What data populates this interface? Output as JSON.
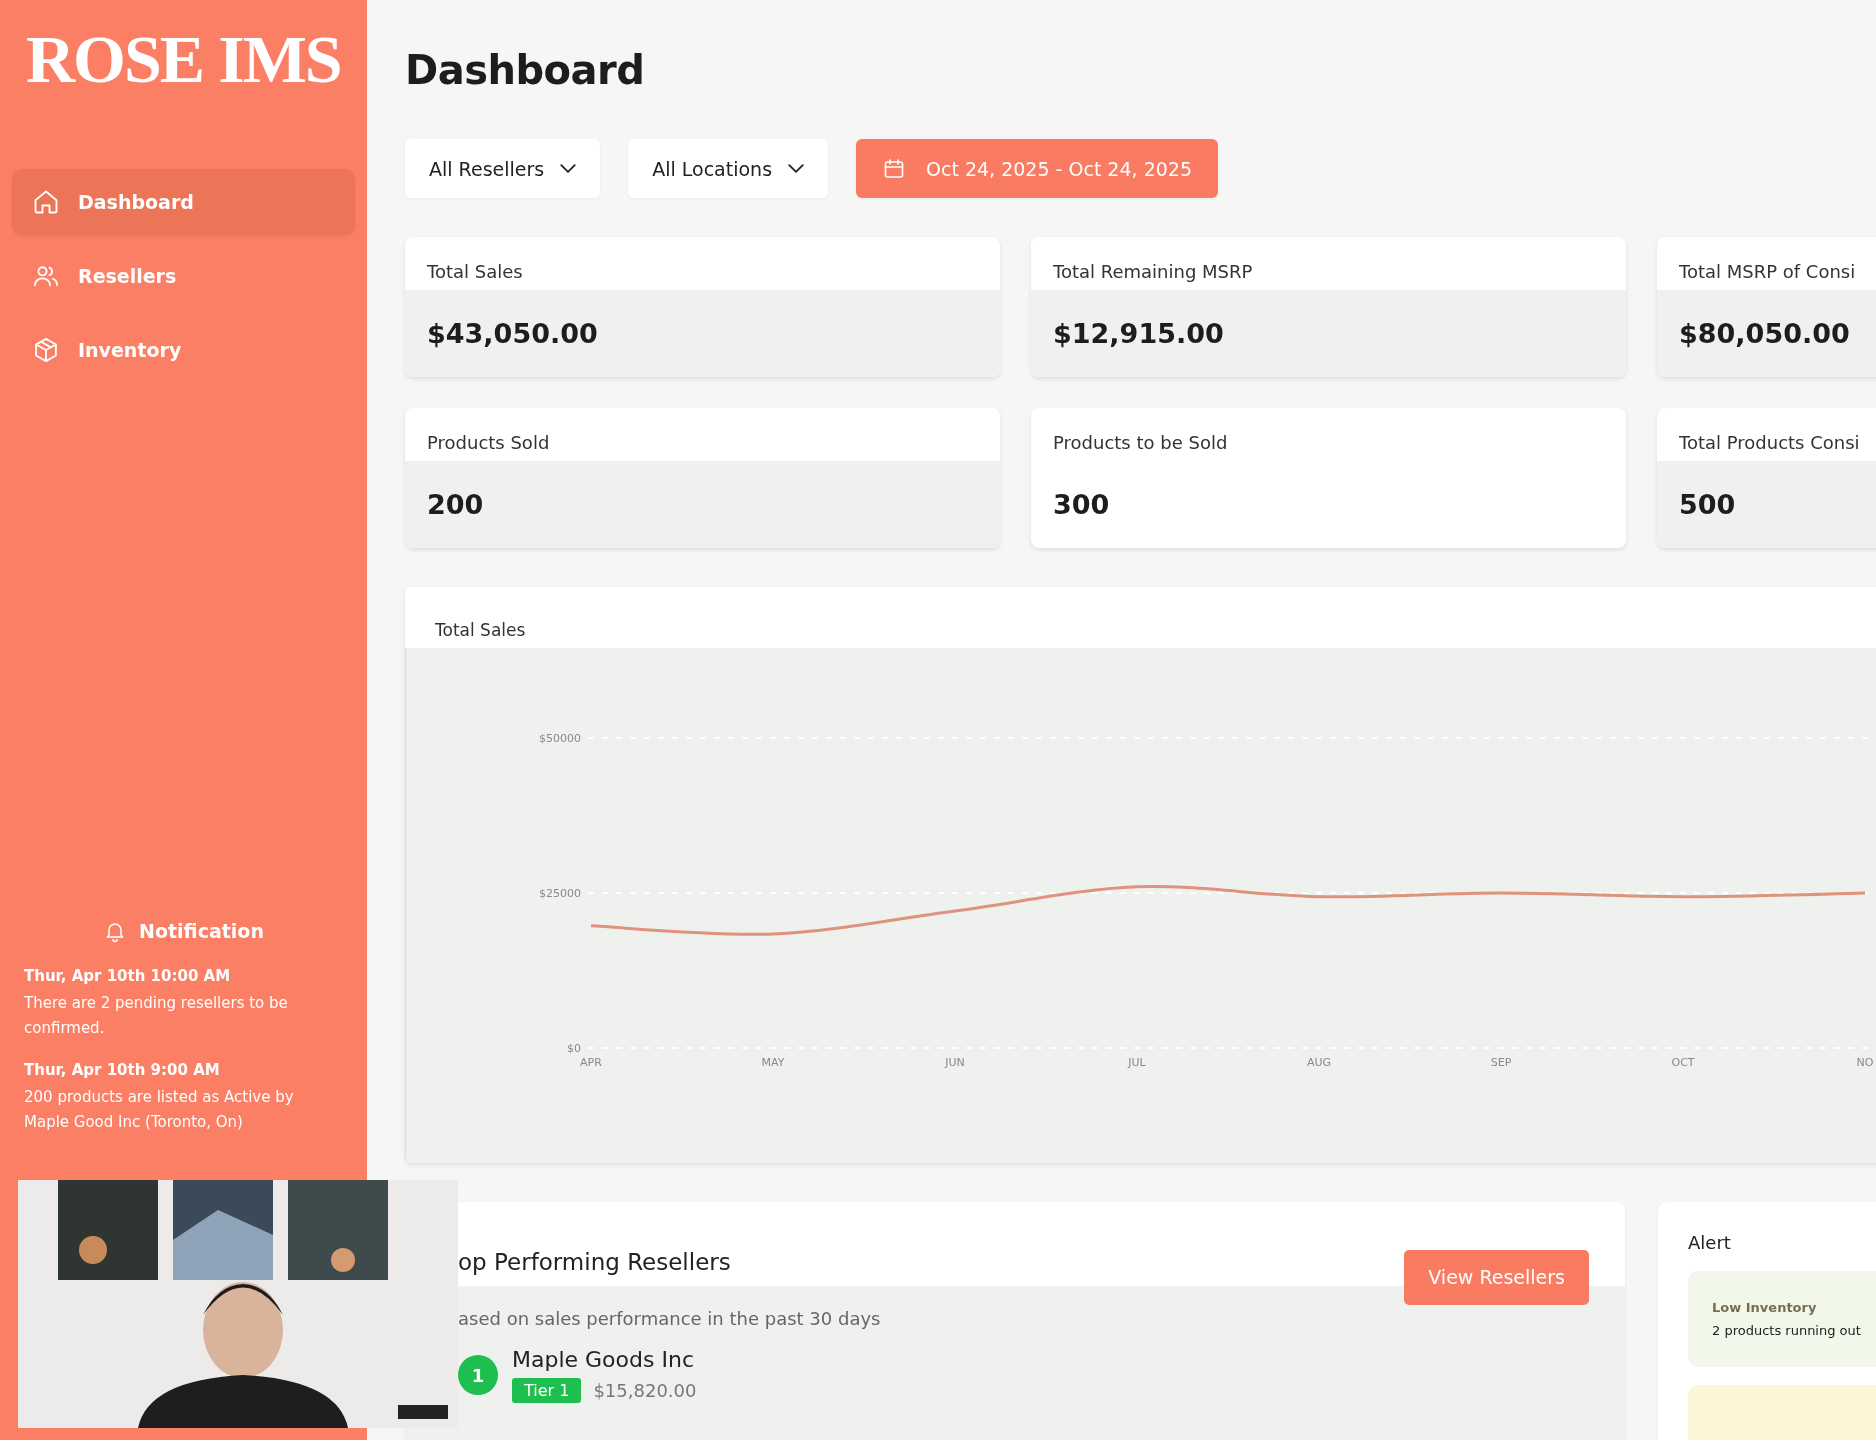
{
  "sidebar": {
    "logo": "ROSE IMS",
    "nav": [
      {
        "label": "Dashboard",
        "selected": true
      },
      {
        "label": "Resellers",
        "selected": false
      },
      {
        "label": "Inventory",
        "selected": false
      }
    ],
    "notifications": {
      "title": "Notification",
      "items": [
        {
          "time": "Thur, Apr 10th 10:00 AM",
          "text": "There are 2 pending resellers to be confirmed."
        },
        {
          "time": "Thur, Apr 10th 9:00 AM",
          "text": "200 products are listed as Active by Maple Good Inc (Toronto, On)"
        }
      ]
    }
  },
  "page_title": "Dashboard",
  "filters": [
    {
      "kind": "dropdown",
      "label": "All Resellers"
    },
    {
      "kind": "dropdown",
      "label": "All Locations"
    },
    {
      "kind": "date",
      "label": "Oct 24, 2025 - Oct 24, 2025"
    }
  ],
  "stats": [
    {
      "title": "Total Sales",
      "value": "$43,050.00",
      "shaded": true
    },
    {
      "title": "Total Remaining MSRP",
      "value": "$12,915.00",
      "shaded": true
    },
    {
      "title": "Total MSRP of Consi",
      "value": "$80,050.00",
      "shaded": true
    },
    {
      "title": "Products Sold",
      "value": "200",
      "shaded": true
    },
    {
      "title": "Products to be Sold",
      "value": "300",
      "shaded": false
    },
    {
      "title": "Total Products Consi",
      "value": "500",
      "shaded": true
    }
  ],
  "sales_chart": {
    "title": "Total Sales",
    "chart_data": {
      "type": "line",
      "categories": [
        "APR",
        "MAY",
        "JUN",
        "JUL",
        "AUG",
        "SEP",
        "OCT",
        "NO"
      ],
      "series": [
        {
          "color": "#e0937c",
          "values": [
            19700,
            18400,
            22100,
            26000,
            24400,
            25000,
            24400,
            25000
          ]
        }
      ],
      "ylim": [
        0,
        50000
      ],
      "yticks": [
        {
          "value": 0,
          "label": "$0"
        },
        {
          "value": 25000,
          "label": "$25000"
        },
        {
          "value": 50000,
          "label": "$50000"
        }
      ]
    }
  },
  "top_resellers": {
    "title": "op Performing Resellers",
    "subtitle": "ased on sales performance in the past 30 days",
    "button": "View Resellers",
    "rows": [
      {
        "rank": "1",
        "name": "Maple Goods Inc",
        "tier": "Tier 1",
        "amount": "$15,820.00"
      }
    ]
  },
  "alerts": {
    "title": "Alert",
    "items": [
      {
        "kind": "success",
        "title": "Low Inventory",
        "text": "2 products running out"
      },
      {
        "kind": "warning"
      }
    ]
  }
}
